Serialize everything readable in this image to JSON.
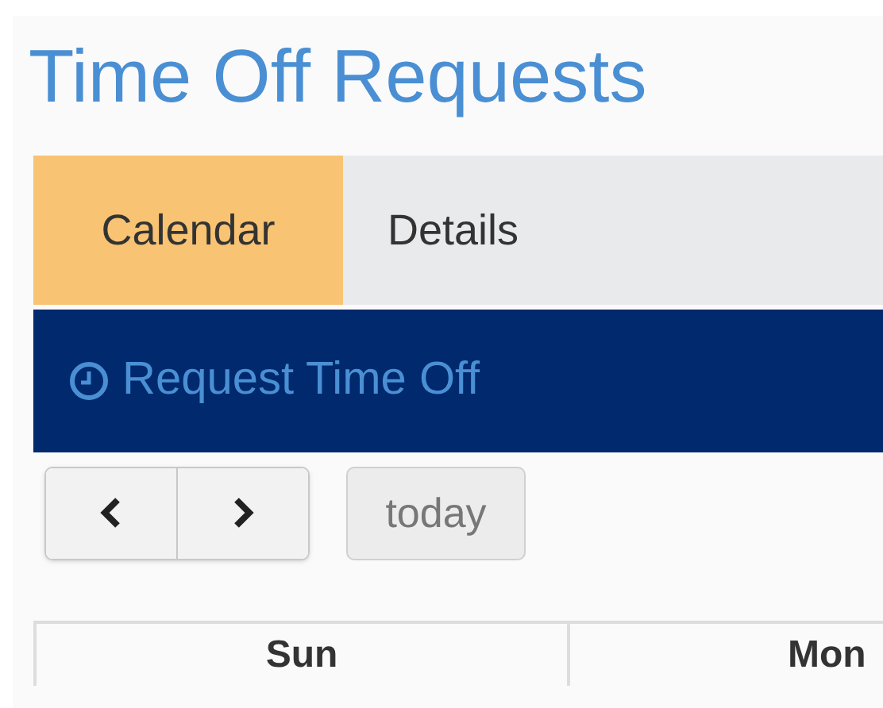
{
  "page": {
    "title": "Time Off Requests"
  },
  "tabs": [
    {
      "label": "Calendar",
      "selected": true
    },
    {
      "label": "Details",
      "selected": false
    }
  ],
  "action_bar": {
    "label": "Request Time Off"
  },
  "toolbar": {
    "today": "today"
  },
  "calendar": {
    "columns": [
      "Sun",
      "Mon"
    ]
  }
}
